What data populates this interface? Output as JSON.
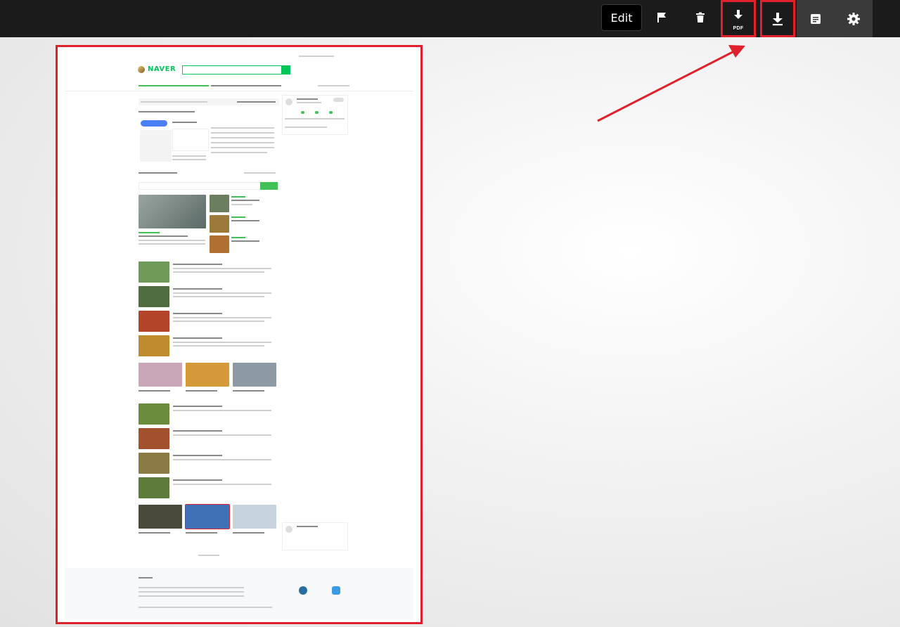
{
  "toolbar": {
    "edit_label": "Edit",
    "icons": [
      "flag-icon",
      "trash-icon",
      "download-pdf-icon",
      "download-icon",
      "document-icon",
      "gear-icon"
    ],
    "pdf_badge": "PDF"
  },
  "annotation": {
    "highlight_color": "#e0202a"
  },
  "preview": {
    "site_logo": "NAVER",
    "brand_color": "#03c75a"
  }
}
